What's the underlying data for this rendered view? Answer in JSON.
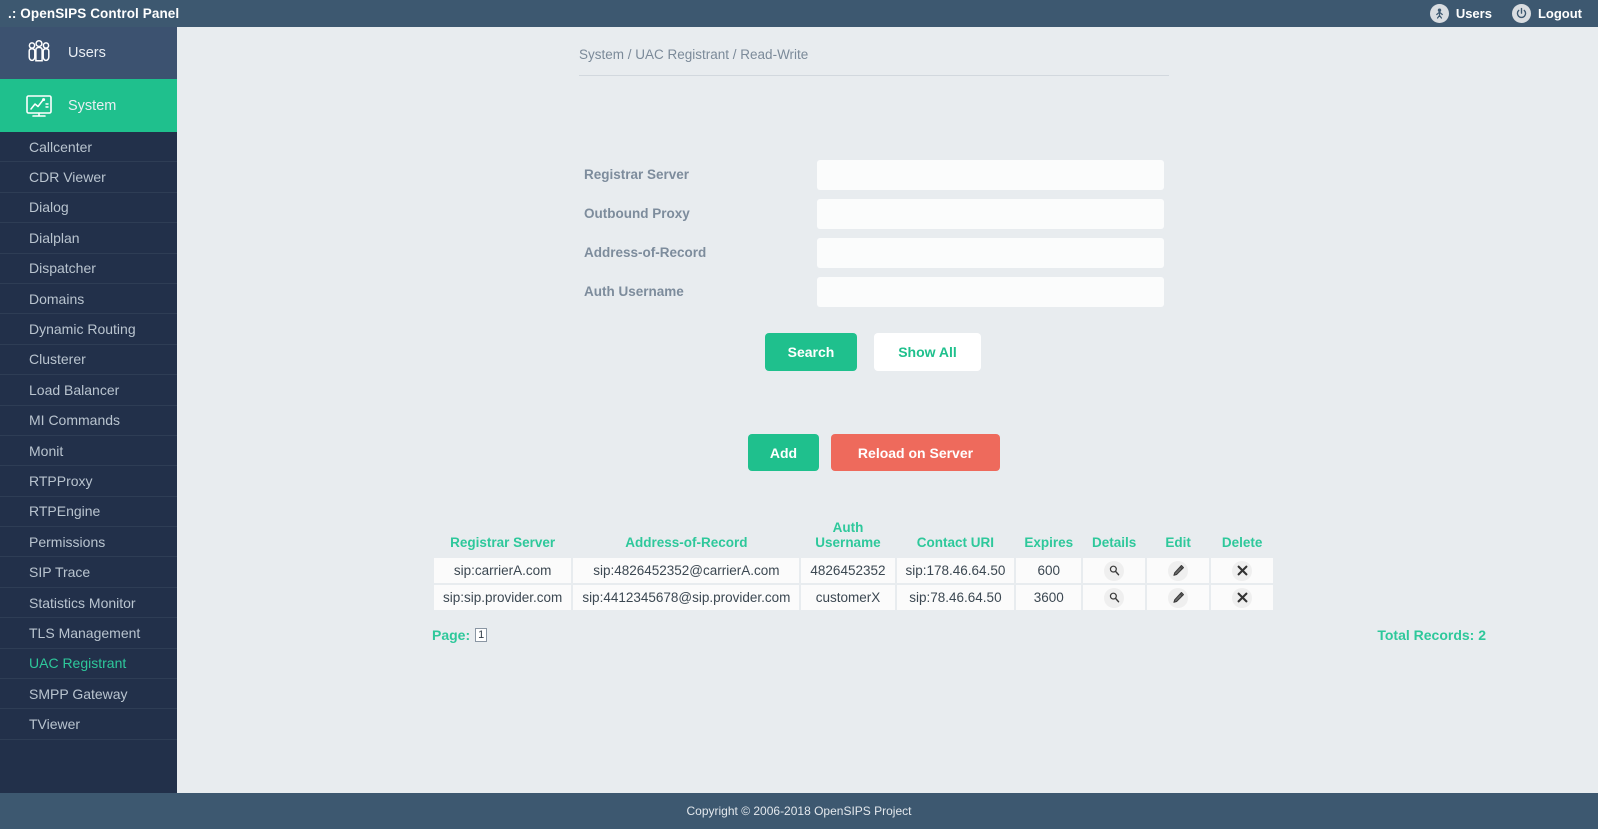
{
  "topbar": {
    "brand": ".: OpenSIPS Control Panel",
    "users_label": "Users",
    "logout_label": "Logout",
    "users_icon": "person-circle-icon",
    "logout_icon": "power-icon"
  },
  "sidebar": {
    "main": [
      {
        "label": "Users",
        "icon": "users-group-icon",
        "active": false
      },
      {
        "label": "System",
        "icon": "monitor-chart-icon",
        "active": true
      }
    ],
    "items": [
      {
        "label": "Callcenter",
        "active": false
      },
      {
        "label": "CDR Viewer",
        "active": false
      },
      {
        "label": "Dialog",
        "active": false
      },
      {
        "label": "Dialplan",
        "active": false
      },
      {
        "label": "Dispatcher",
        "active": false
      },
      {
        "label": "Domains",
        "active": false
      },
      {
        "label": "Dynamic Routing",
        "active": false
      },
      {
        "label": "Clusterer",
        "active": false
      },
      {
        "label": "Load Balancer",
        "active": false
      },
      {
        "label": "MI Commands",
        "active": false
      },
      {
        "label": "Monit",
        "active": false
      },
      {
        "label": "RTPProxy",
        "active": false
      },
      {
        "label": "RTPEngine",
        "active": false
      },
      {
        "label": "Permissions",
        "active": false
      },
      {
        "label": "SIP Trace",
        "active": false
      },
      {
        "label": "Statistics Monitor",
        "active": false
      },
      {
        "label": "TLS Management",
        "active": false
      },
      {
        "label": "UAC Registrant",
        "active": true
      },
      {
        "label": "SMPP Gateway",
        "active": false
      },
      {
        "label": "TViewer",
        "active": false
      }
    ]
  },
  "breadcrumb": "System / UAC Registrant / Read-Write",
  "search_form": {
    "fields": [
      {
        "label": "Registrar Server",
        "value": "",
        "placeholder": ""
      },
      {
        "label": "Outbound Proxy",
        "value": "",
        "placeholder": ""
      },
      {
        "label": "Address-of-Record",
        "value": "",
        "placeholder": ""
      },
      {
        "label": "Auth Username",
        "value": "",
        "placeholder": ""
      }
    ],
    "search_label": "Search",
    "show_all_label": "Show All"
  },
  "actions": {
    "add_label": "Add",
    "reload_label": "Reload on Server"
  },
  "table": {
    "headers": [
      "Registrar Server",
      "Address-of-Record",
      "Auth Username",
      "Contact URI",
      "Expires",
      "Details",
      "Edit",
      "Delete"
    ],
    "rows": [
      {
        "registrar_server": "sip:carrierA.com",
        "address_of_record": "sip:4826452352@carrierA.com",
        "auth_username": "4826452352",
        "contact_uri": "sip:178.46.64.50",
        "expires": "600",
        "details_icon": "magnifier-icon",
        "edit_icon": "pencil-icon",
        "delete_icon": "cross-icon"
      },
      {
        "registrar_server": "sip:sip.provider.com",
        "address_of_record": "sip:4412345678@sip.provider.com",
        "auth_username": "customerX",
        "contact_uri": "sip:78.46.64.50",
        "expires": "3600",
        "details_icon": "magnifier-icon",
        "edit_icon": "pencil-icon",
        "delete_icon": "cross-icon"
      }
    ],
    "page_label": "Page:",
    "page_value": "1",
    "total_records": "Total Records: 2"
  },
  "footer": {
    "copyright": "Copyright © 2006-2018 OpenSIPS Project"
  },
  "colors": {
    "accent_teal": "#1fc08d",
    "header_teal": "#2ec89b",
    "danger_red": "#ee6a5c",
    "topbar_blue": "#3d5870",
    "sidebar_dark": "#22304a",
    "page_bg": "#e8ecef"
  }
}
